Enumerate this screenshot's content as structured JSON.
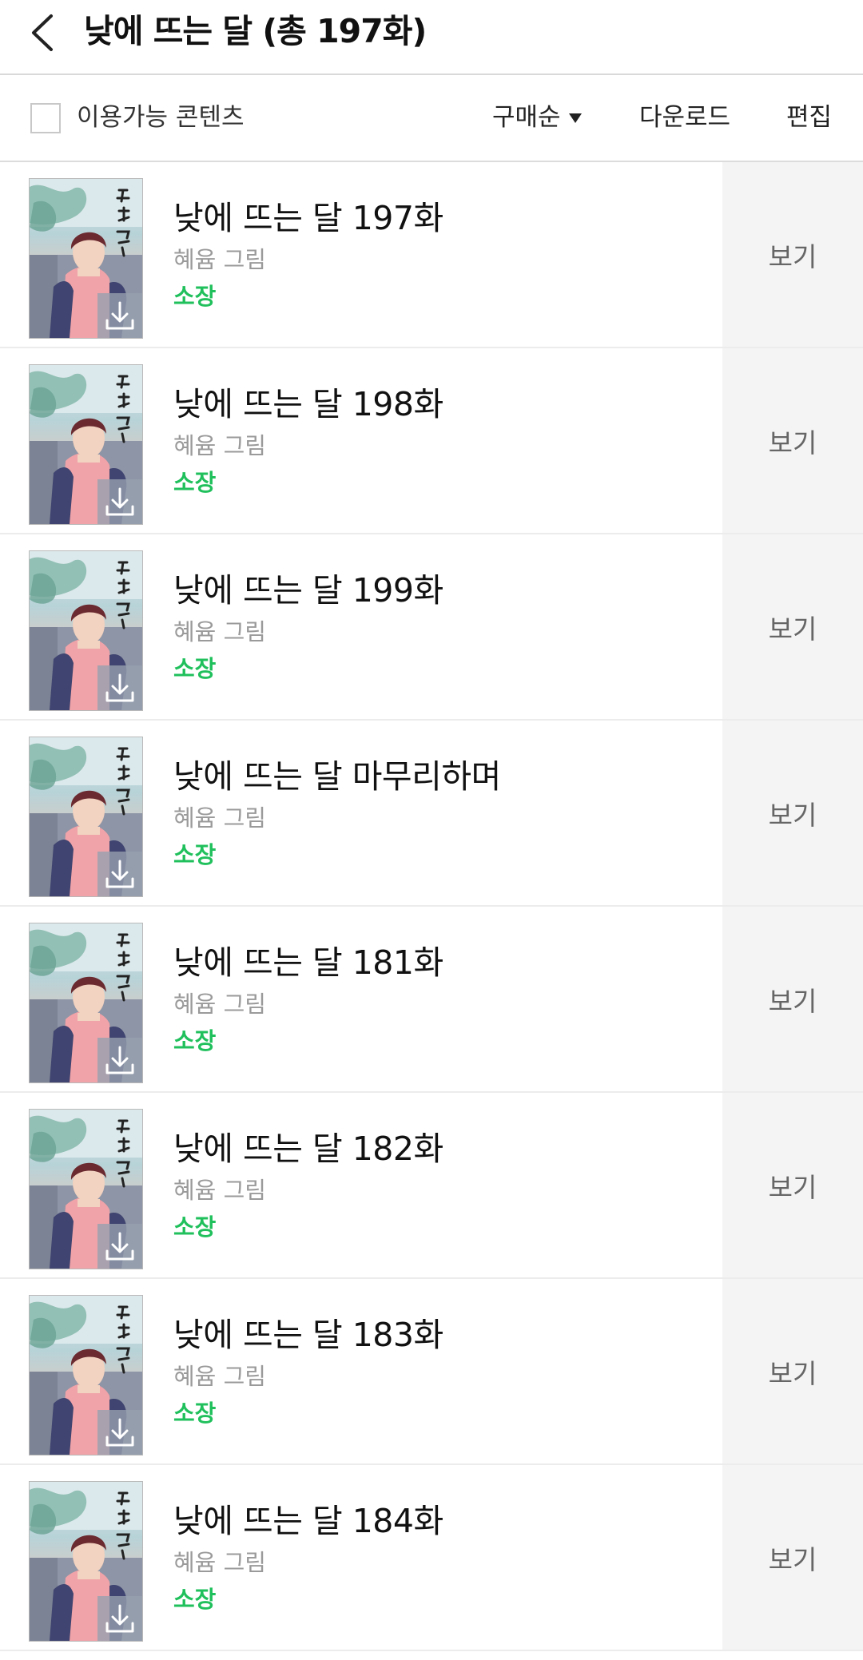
{
  "header": {
    "title": "낮에 뜨는 달 (총 197화)"
  },
  "toolbar": {
    "filter_label": "이용가능 콘텐츠",
    "sort_label": "구매순",
    "download_label": "다운로드",
    "edit_label": "편집"
  },
  "episodes": [
    {
      "title": "낮에 뜨는 달 197화",
      "author": "혜윰 그림",
      "status": "소장",
      "action": "보기"
    },
    {
      "title": "낮에 뜨는 달 198화",
      "author": "혜윰 그림",
      "status": "소장",
      "action": "보기"
    },
    {
      "title": "낮에 뜨는 달 199화",
      "author": "혜윰 그림",
      "status": "소장",
      "action": "보기"
    },
    {
      "title": "낮에 뜨는 달 마무리하며",
      "author": "혜윰 그림",
      "status": "소장",
      "action": "보기"
    },
    {
      "title": "낮에 뜨는 달 181화",
      "author": "혜윰 그림",
      "status": "소장",
      "action": "보기"
    },
    {
      "title": "낮에 뜨는 달 182화",
      "author": "혜윰 그림",
      "status": "소장",
      "action": "보기"
    },
    {
      "title": "낮에 뜨는 달 183화",
      "author": "혜윰 그림",
      "status": "소장",
      "action": "보기"
    },
    {
      "title": "낮에 뜨는 달 184화",
      "author": "혜윰 그림",
      "status": "소장",
      "action": "보기"
    }
  ],
  "colors": {
    "status_green": "#20c05c",
    "view_bg": "#f4f4f4",
    "muted_text": "#9a9a9a"
  },
  "icons": {
    "back": "chevron-left-icon",
    "sort": "caret-down-icon",
    "download_badge": "download-icon"
  }
}
